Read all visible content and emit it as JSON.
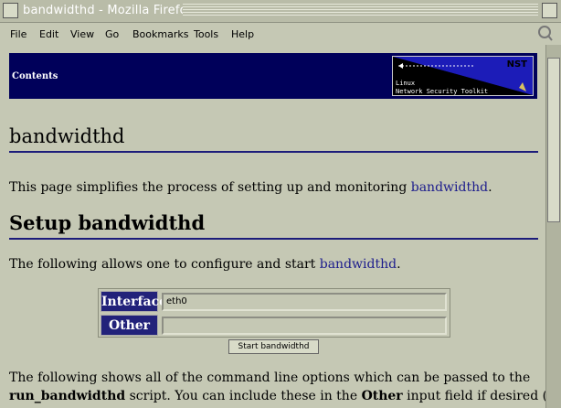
{
  "window": {
    "title": "bandwidthd - Mozilla Firefox"
  },
  "menu": [
    "File",
    "Edit",
    "View",
    "Go",
    "Bookmarks",
    "Tools",
    "Help"
  ],
  "header": {
    "contents_label": "Contents",
    "logo_brand": "NST",
    "logo_line1": "Linux",
    "logo_line2": "Network Security Toolkit"
  },
  "page": {
    "title": "bandwidthd",
    "intro_text": "This page simplifies the process of setting up and monitoring ",
    "intro_link": "bandwidthd",
    "intro_end": "."
  },
  "setup": {
    "heading": "Setup bandwidthd",
    "text": "The following allows one to configure and start ",
    "link": "bandwidthd",
    "text_end": ".",
    "interface_label": "Interface",
    "interface_value": "eth0",
    "other_label": "Other",
    "other_value": "",
    "submit_label": "Start bandwidthd"
  },
  "options": {
    "line1": "The following shows all of the command line options which can be passed to the",
    "script_name": "run_bandwidthd",
    "line2_mid": " script. You can include these in the ",
    "other_bold": "Other",
    "line2_end": " input field if desired (typically"
  }
}
